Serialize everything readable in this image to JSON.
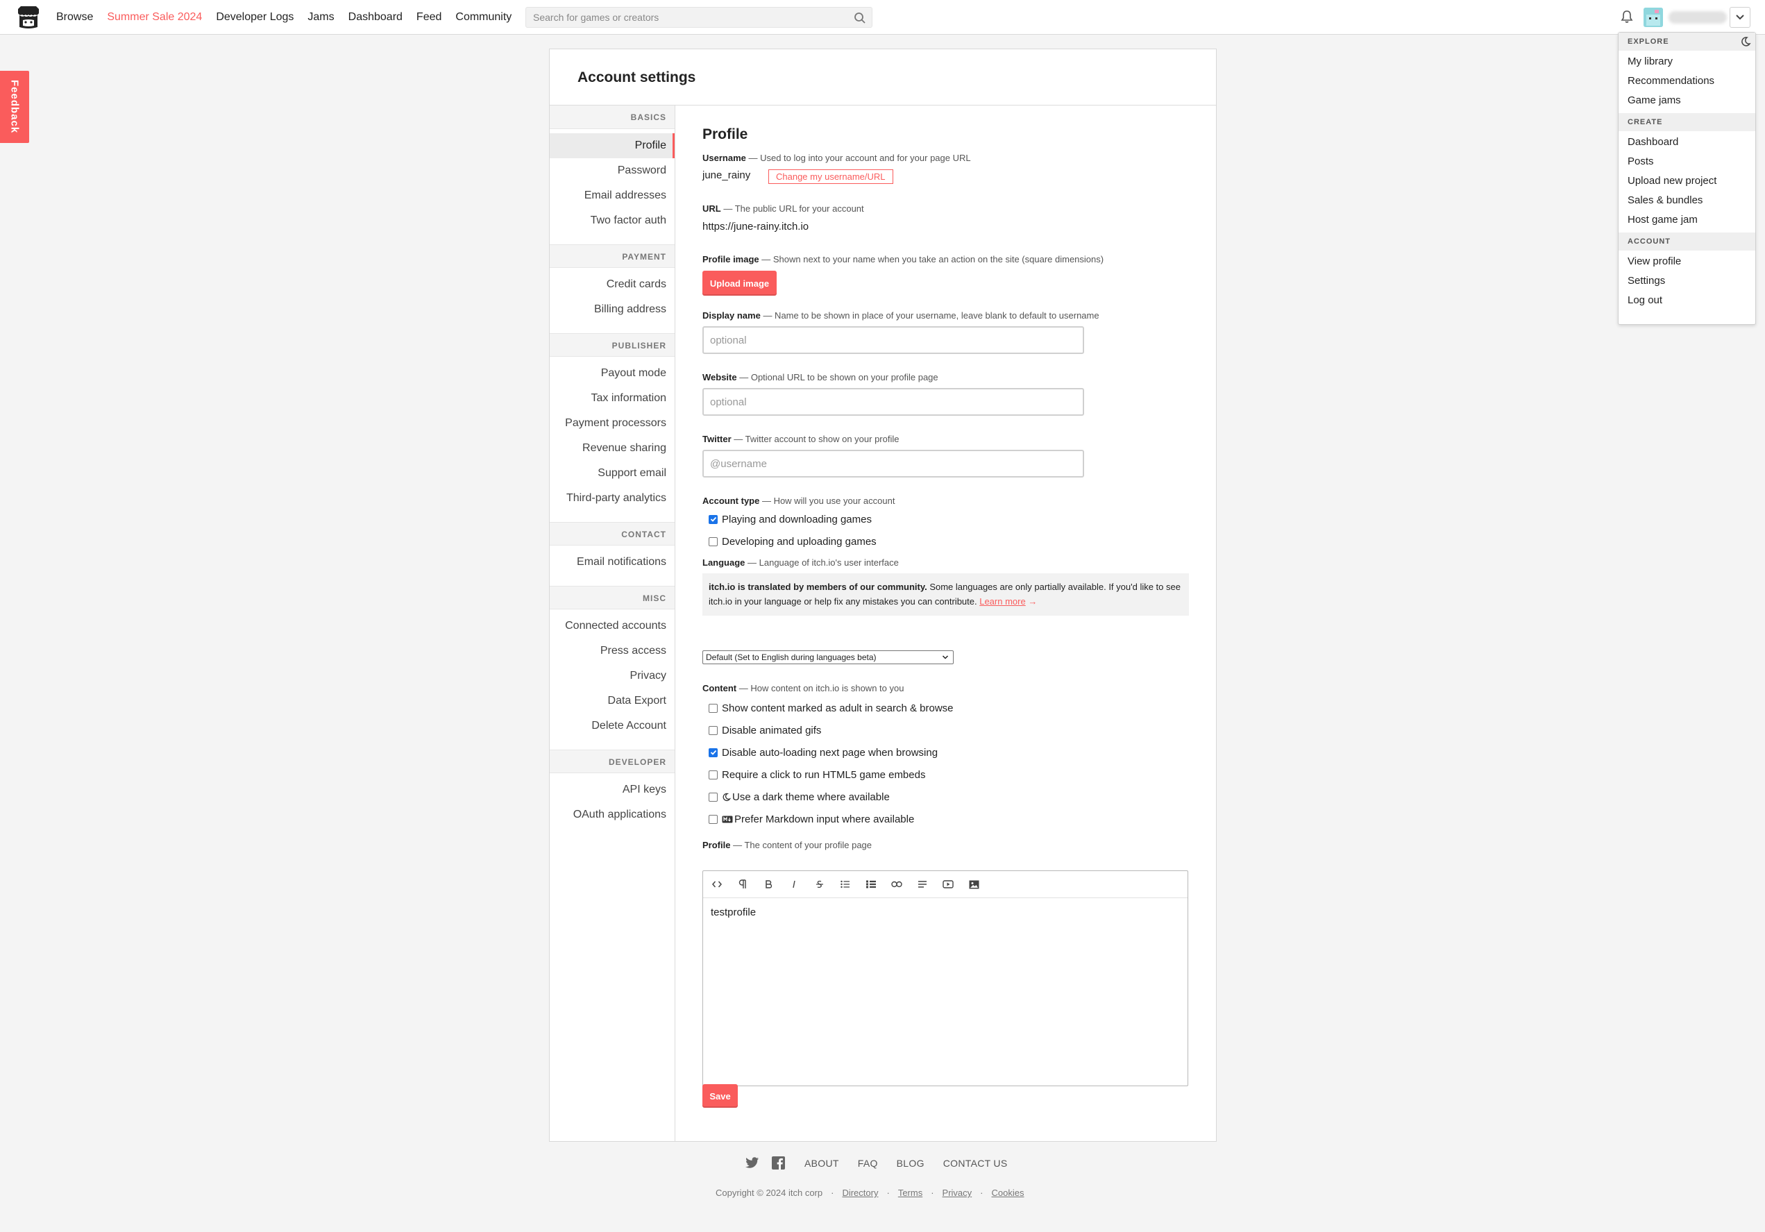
{
  "header": {
    "nav": [
      "Browse",
      "Summer Sale 2024",
      "Developer Logs",
      "Jams",
      "Dashboard",
      "Feed",
      "Community"
    ],
    "search_placeholder": "Search for games or creators"
  },
  "feedback_label": "Feedback",
  "dropdown": {
    "explore": "EXPLORE",
    "explore_items": [
      "My library",
      "Recommendations",
      "Game jams"
    ],
    "create": "CREATE",
    "create_items": [
      "Dashboard",
      "Posts",
      "Upload new project",
      "Sales & bundles",
      "Host game jam"
    ],
    "account": "ACCOUNT",
    "account_items": [
      "View profile",
      "Settings",
      "Log out"
    ]
  },
  "panel": {
    "title": "Account settings"
  },
  "sidebar": {
    "basics": "BASICS",
    "basics_items": [
      "Profile",
      "Password",
      "Email addresses",
      "Two factor auth"
    ],
    "payment": "PAYMENT",
    "payment_items": [
      "Credit cards",
      "Billing address"
    ],
    "publisher": "PUBLISHER",
    "publisher_items": [
      "Payout mode",
      "Tax information",
      "Payment processors",
      "Revenue sharing",
      "Support email",
      "Third-party analytics"
    ],
    "contact": "CONTACT",
    "contact_items": [
      "Email notifications"
    ],
    "misc": "MISC",
    "misc_items": [
      "Connected accounts",
      "Press access",
      "Privacy",
      "Data Export",
      "Delete Account"
    ],
    "developer": "DEVELOPER",
    "developer_items": [
      "API keys",
      "OAuth applications"
    ]
  },
  "profile": {
    "heading": "Profile",
    "username_label": "Username",
    "username_desc": " — Used to log into your account and for your page URL",
    "username_value": "june_rainy",
    "change_username": "Change my username/URL",
    "url_label": "URL",
    "url_desc": " — The public URL for your account",
    "url_value": "https://june-rainy.itch.io",
    "image_label": "Profile image",
    "image_desc": " — Shown next to your name when you take an action on the site (square dimensions)",
    "upload_image": "Upload image",
    "display_label": "Display name",
    "display_desc": " — Name to be shown in place of your username, leave blank to default to username",
    "display_placeholder": "optional",
    "website_label": "Website",
    "website_desc": " — Optional URL to be shown on your profile page",
    "website_placeholder": "optional",
    "twitter_label": "Twitter",
    "twitter_desc": " — Twitter account to show on your profile",
    "twitter_placeholder": "@username",
    "acct_label": "Account type",
    "acct_desc": " — How will you use your account",
    "acct_opt1": "Playing and downloading games",
    "acct_opt2": "Developing and uploading games",
    "lang_label": "Language",
    "lang_desc": " — Language of itch.io's user interface",
    "lang_bold": "itch.io is translated by members of our community.",
    "lang_text": " Some languages are only partially available. If you'd like to see itch.io in your language or help fix any mistakes you can contribute. ",
    "lang_link": "Learn more",
    "lang_arrow": "→",
    "lang_select": "Default (Set to English during languages beta)",
    "content_label": "Content",
    "content_desc": " — How content on itch.io is shown to you",
    "content_opts": [
      "Show content marked as adult in search & browse",
      "Disable animated gifs",
      "Disable auto-loading next page when browsing",
      "Require a click to run HTML5 game embeds",
      "Use a dark theme where available",
      "Prefer Markdown input where available"
    ],
    "profile_label": "Profile",
    "profile_desc": " — The content of your profile page",
    "profile_text": "testprofile",
    "save": "Save"
  },
  "footer": {
    "links": [
      "ABOUT",
      "FAQ",
      "BLOG",
      "CONTACT US"
    ],
    "copyright": "Copyright © 2024 itch corp",
    "bottom_links": [
      "Directory",
      "Terms",
      "Privacy",
      "Cookies"
    ],
    "dot": "·"
  },
  "colors": {
    "accent": "#fa5c5c",
    "checkbox": "#1a73e8"
  }
}
